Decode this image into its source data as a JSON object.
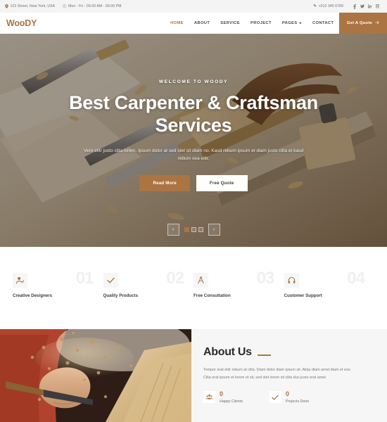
{
  "topbar": {
    "address": "123 Street, New York, USA",
    "hours": "Mon - Fri : 09.00 AM - 09.00 PM",
    "phone": "+012 345 6789",
    "socials": [
      {
        "name": "facebook",
        "glyph": "f"
      },
      {
        "name": "twitter",
        "glyph": "t"
      },
      {
        "name": "linkedin",
        "glyph": "in"
      },
      {
        "name": "instagram",
        "glyph": "ig"
      }
    ]
  },
  "navbar": {
    "logo": "WooDY",
    "menu": [
      {
        "label": "HOME",
        "active": true
      },
      {
        "label": "ABOUT",
        "active": false
      },
      {
        "label": "SERVICE",
        "active": false
      },
      {
        "label": "PROJECT",
        "active": false
      },
      {
        "label": "PAGES",
        "active": false,
        "dropdown": true
      },
      {
        "label": "CONTACT",
        "active": false
      }
    ],
    "quote_label": "Get A Quote"
  },
  "hero": {
    "welcome": "WELCOME TO WOODY",
    "title": "Best Carpenter & Craftsman Services",
    "text": "Vero elitr justo clita lorem. Ipsum dolor at sed stet sit diam no. Kasd rebum ipsum et diam justo clita et kasd rebum sea elitr.",
    "btn_primary": "Read More",
    "btn_secondary": "Free Quote",
    "carousel": {
      "prev": "‹",
      "next": "›",
      "slides": 3,
      "active_index": 0
    }
  },
  "features": [
    {
      "num": "01",
      "label": "Creative Designers",
      "icon": "user-check-icon"
    },
    {
      "num": "02",
      "label": "Quality Products",
      "icon": "check-icon"
    },
    {
      "num": "03",
      "label": "Free Consultation",
      "icon": "drafting-compass-icon"
    },
    {
      "num": "04",
      "label": "Customer Support",
      "icon": "headphones-icon"
    }
  ],
  "about": {
    "title": "About Us",
    "text": "Tempor erat elitr rebum at clita. Diam dolor diam ipsum sit. Aliqu diam amet diam et eos. Clita erat ipsum et lorem et sit, sed stet lorem sit clita duo justo erat amet.",
    "stats": [
      {
        "value": "0",
        "label": "Happy Clients",
        "icon": "users-icon"
      },
      {
        "value": "0",
        "label": "Projects Done",
        "icon": "check-icon"
      }
    ]
  },
  "colors": {
    "accent": "#ab7442",
    "topbar_bg": "#f4f4f4",
    "section_bg": "#f6f6f6",
    "number_grey": "#f0f0f0"
  }
}
